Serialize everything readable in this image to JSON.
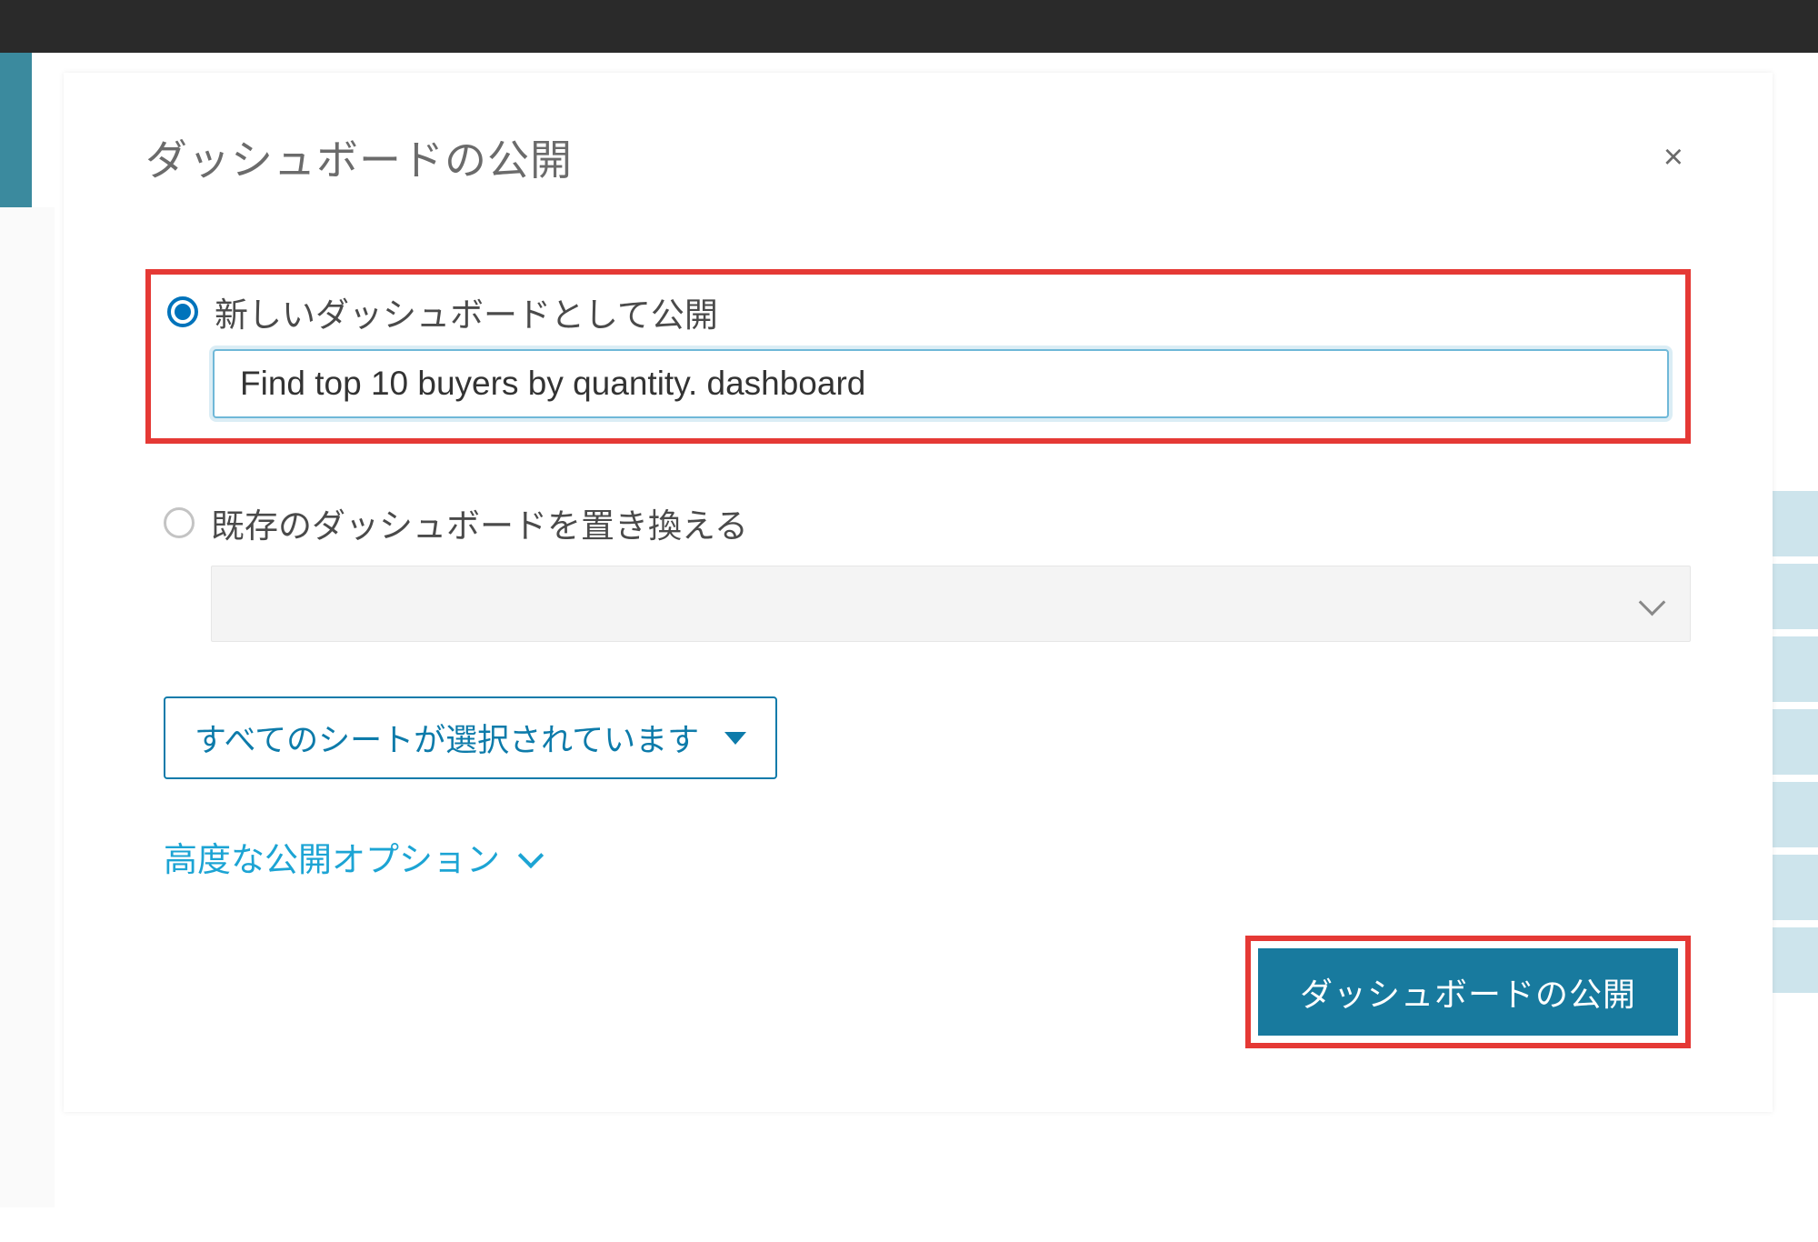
{
  "modal": {
    "title": "ダッシュボードの公開",
    "close_symbol": "×",
    "option_new": {
      "label": "新しいダッシュボードとして公開",
      "input_value": "Find top 10 buyers by quantity. dashboard"
    },
    "option_replace": {
      "label": "既存のダッシュボードを置き換える"
    },
    "sheets_dropdown": {
      "label": "すべてのシートが選択されています"
    },
    "advanced_link": {
      "label": "高度な公開オプション"
    },
    "publish_button": {
      "label": "ダッシュボードの公開"
    }
  }
}
